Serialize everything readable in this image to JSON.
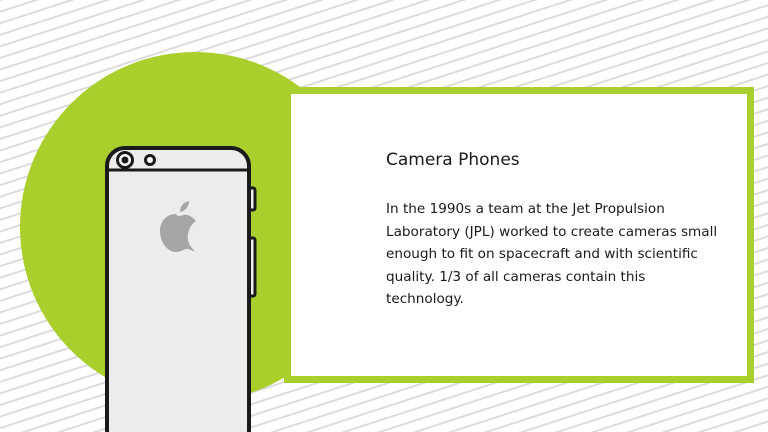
{
  "colors": {
    "accent_green": "#a8cf2c",
    "phone_body": "#ececec",
    "phone_outline": "#1a1a1a",
    "logo_gray": "#a6a6a6",
    "text": "#1a1a1a"
  },
  "illustration": {
    "device_icon": "phone-back-icon",
    "logo_icon": "apple-logo-icon"
  },
  "card": {
    "title": "Camera Phones",
    "body": "In the 1990s a team at the Jet Propulsion Laboratory (JPL) worked to create cameras small enough to fit on spacecraft and with scientific quality. 1/3 of all cameras contain this technology."
  }
}
